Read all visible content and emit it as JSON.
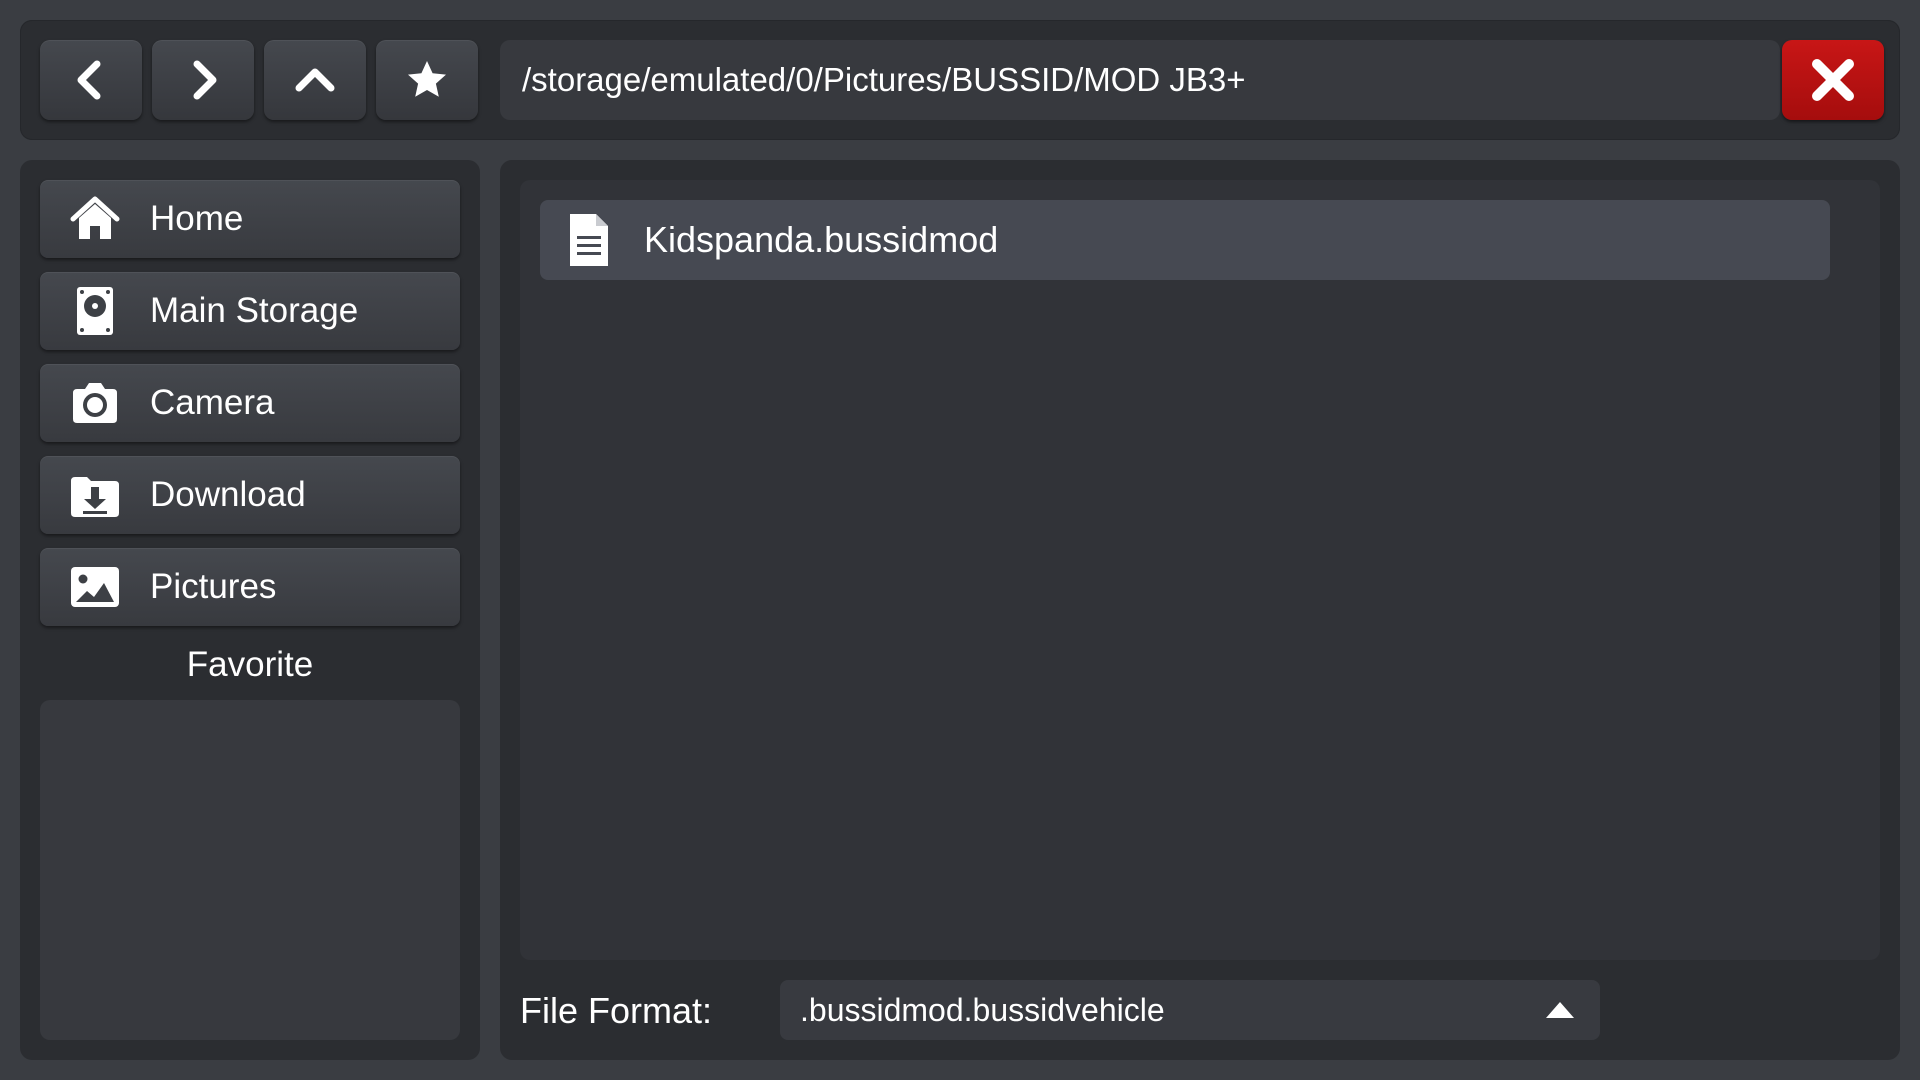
{
  "toolbar": {
    "back_icon": "chevron-left-icon",
    "forward_icon": "chevron-right-icon",
    "up_icon": "chevron-up-icon",
    "favorite_icon": "star-icon",
    "path": "/storage/emulated/0/Pictures/BUSSID/MOD JB3+",
    "close_icon": "close-icon",
    "close_color": "#b31010"
  },
  "sidebar": {
    "items": [
      {
        "label": "Home",
        "icon": "home-icon"
      },
      {
        "label": "Main Storage",
        "icon": "storage-icon"
      },
      {
        "label": "Camera",
        "icon": "camera-icon"
      },
      {
        "label": "Download",
        "icon": "download-icon"
      },
      {
        "label": "Pictures",
        "icon": "image-icon"
      }
    ],
    "favorite_title": "Favorite",
    "favorites": []
  },
  "main": {
    "files": [
      {
        "name": "Kidspanda.bussidmod",
        "icon": "document-icon"
      }
    ],
    "file_format_label": "File Format:",
    "file_format_value": ".bussidmod.bussidvehicle",
    "file_format_arrow_icon": "triangle-up-icon"
  }
}
